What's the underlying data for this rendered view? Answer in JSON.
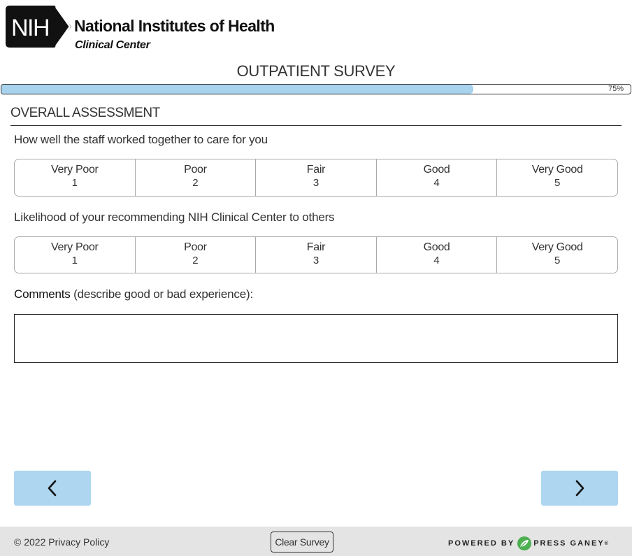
{
  "header": {
    "logo_badge_text": "NIH",
    "org_name": "National Institutes of Health",
    "org_sub": "Clinical Center"
  },
  "survey": {
    "title": "OUTPATIENT SURVEY",
    "progress_label": "75%",
    "progress_fraction": 0.75
  },
  "section": {
    "title": "OVERALL ASSESSMENT"
  },
  "questions": [
    {
      "text": "How well the staff worked together to care for you",
      "options": [
        {
          "label": "Very Poor",
          "value": "1"
        },
        {
          "label": "Poor",
          "value": "2"
        },
        {
          "label": "Fair",
          "value": "3"
        },
        {
          "label": "Good",
          "value": "4"
        },
        {
          "label": "Very Good",
          "value": "5"
        }
      ]
    },
    {
      "text": "Likelihood of your recommending NIH Clinical Center to others",
      "options": [
        {
          "label": "Very Poor",
          "value": "1"
        },
        {
          "label": "Poor",
          "value": "2"
        },
        {
          "label": "Fair",
          "value": "3"
        },
        {
          "label": "Good",
          "value": "4"
        },
        {
          "label": "Very Good",
          "value": "5"
        }
      ]
    }
  ],
  "comments": {
    "label_bold": "Comments",
    "label_rest": " (describe good or bad experience):",
    "value": ""
  },
  "nav": {
    "prev_icon": "chevron-left-icon",
    "next_icon": "chevron-right-icon"
  },
  "footer": {
    "copyright": "© 2022",
    "privacy_link": "Privacy Policy",
    "clear_button": "Clear Survey",
    "powered_by": "POWERED BY",
    "brand": "PRESS GANEY",
    "brand_mark": "®"
  },
  "colors": {
    "progress_fill": "#a8d3ee",
    "nav_button": "#aed6f0",
    "footer_bg": "#e4e4e4",
    "brand_green": "#4caf50"
  }
}
